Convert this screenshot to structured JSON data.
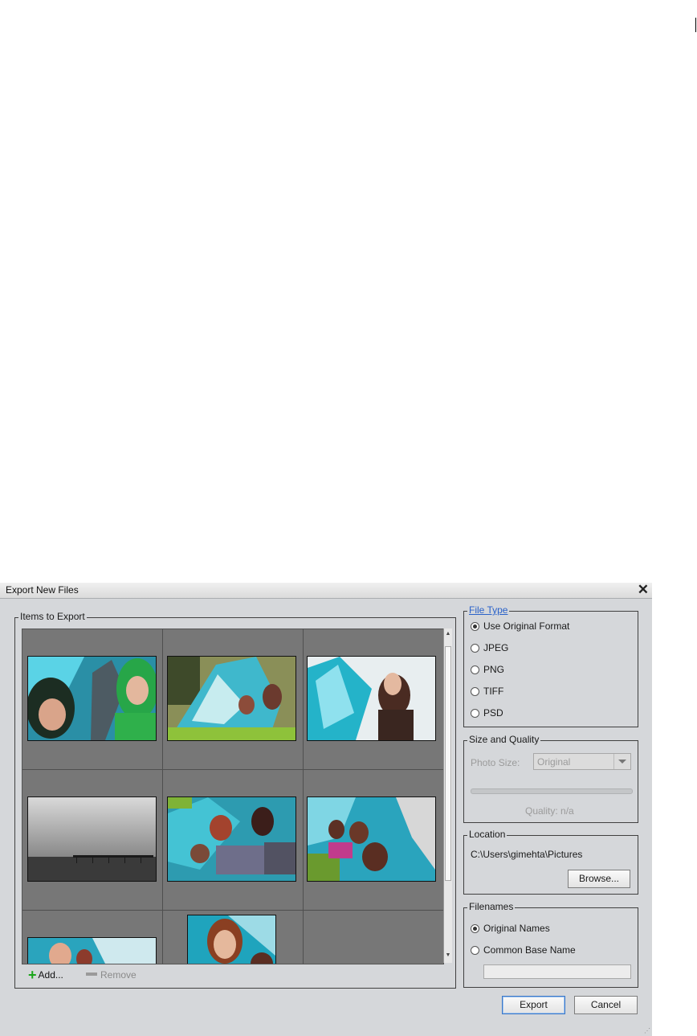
{
  "dialog": {
    "title": "Export New Files",
    "close_glyph": "✕"
  },
  "items_group": {
    "legend": "Items to Export",
    "add_label": "Add...",
    "remove_label": "Remove"
  },
  "file_type": {
    "legend": "File Type",
    "options": [
      "Use Original Format",
      "JPEG",
      "PNG",
      "TIFF",
      "PSD"
    ],
    "selected": "Use Original Format"
  },
  "size_quality": {
    "legend": "Size and Quality",
    "photo_size_label": "Photo Size:",
    "photo_size_value": "Original",
    "quality_label": "Quality: n/a"
  },
  "location": {
    "legend": "Location",
    "path": "C:\\Users\\gimehta\\Pictures",
    "browse_label": "Browse..."
  },
  "filenames": {
    "legend": "Filenames",
    "options": [
      "Original Names",
      "Common Base Name"
    ],
    "selected": "Original Names"
  },
  "footer": {
    "export_label": "Export",
    "cancel_label": "Cancel"
  },
  "icons": [
    "close-icon",
    "add-icon",
    "remove-icon",
    "scroll-up-icon",
    "scroll-down-icon",
    "dropdown-arrow-icon",
    "resize-grip-icon"
  ]
}
